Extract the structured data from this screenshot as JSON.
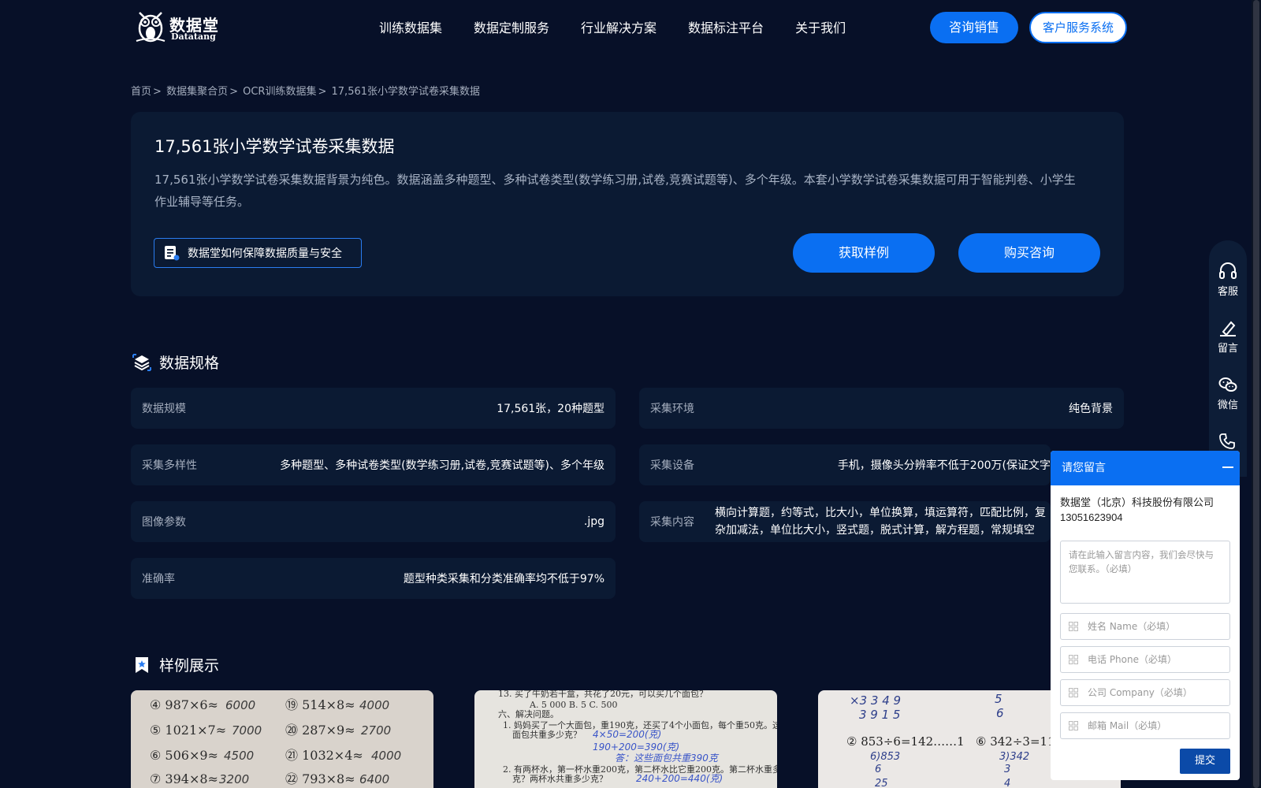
{
  "header": {
    "logo_cn": "数据堂",
    "logo_en": "Datatang",
    "nav": [
      "训练数据集",
      "数据定制服务",
      "行业解决方案",
      "数据标注平台",
      "关于我们"
    ],
    "sales_button": "咨询销售",
    "cs_button": "客户服务系统"
  },
  "breadcrumb": {
    "items": [
      "首页",
      "数据集聚合页",
      "OCR训练数据集",
      "17,561张小学数学试卷采集数据"
    ],
    "separator": ">"
  },
  "hero": {
    "title": "17,561张小学数学试卷采集数据",
    "description": "17,561张小学数学试卷采集数据背景为纯色。数据涵盖多种题型、多种试卷类型(数学练习册,试卷,竞赛试题等)、多个年级。本套小学数学试卷采集数据可用于智能判卷、小学生作业辅导等任务。",
    "quality_link": "数据堂如何保障数据质量与安全",
    "sample_button": "获取样例",
    "buy_button": "购买咨询"
  },
  "specs": {
    "title": "数据规格",
    "items": [
      {
        "label": "数据规模",
        "value": "17,561张，20种题型"
      },
      {
        "label": "采集环境",
        "value": "纯色背景"
      },
      {
        "label": "采集多样性",
        "value": "多种题型、多种试卷类型(数学练习册,试卷,竞赛试题等)、多个年级"
      },
      {
        "label": "采集设备",
        "value": "手机，摄像头分辨率不低于200万(保证文字"
      },
      {
        "label": "图像参数",
        "value": ".jpg"
      },
      {
        "label": "采集内容",
        "value": "横向计算题，约等式，比大小，单位换算，填运算符，匹配比例，复杂加减法，单位比大小，竖式题，脱式计算，解方程题，常规填空题，"
      },
      {
        "label": "准确率",
        "value": "题型种类采集和分类准确率均不低于97%"
      }
    ]
  },
  "samples": {
    "title": "样例展示"
  },
  "sidebar": {
    "items": [
      "客服",
      "留言",
      "微信"
    ]
  },
  "message_panel": {
    "title": "请您留言",
    "company": "数据堂（北京）科技股份有限公司",
    "phone": "13051623904",
    "message_placeholder": "请在此输入留言内容，我们会尽快与您联系。（必填）",
    "name_placeholder": "姓名 Name（必填）",
    "phone_placeholder": "电话 Phone（必填）",
    "company_placeholder": "公司 Company（必填）",
    "mail_placeholder": "邮箱 Mail（必填）",
    "submit": "提交"
  },
  "colors": {
    "page_bg": "#071028",
    "card_bg": "#0b1a33",
    "accent": "#0a6ff2"
  }
}
